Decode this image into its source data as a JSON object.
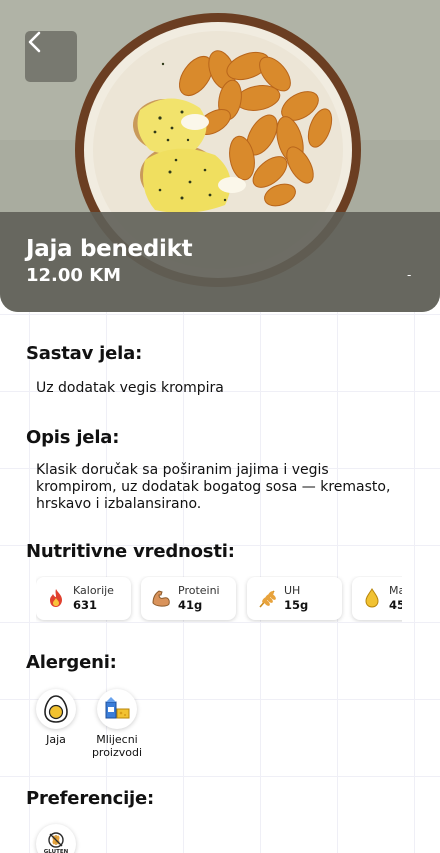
{
  "dish": {
    "name": "Jaja benedikt",
    "price": "12.00 KM",
    "dash": "-"
  },
  "sections": {
    "ingredients_title": "Sastav jela:",
    "ingredients_text": "Uz dodatak vegis krompira",
    "description_title": "Opis jela:",
    "description_text": "Klasik doručak sa poširanim jajima i vegis krompirom, uz dodatak bogatog sosa — kremasto, hrskavo i izbalansirano.",
    "nutrition_title": "Nutritivne vrednosti:",
    "allergens_title": "Alergeni:",
    "preferences_title": "Preferencije:"
  },
  "nutrition": [
    {
      "label": "Kalorije",
      "value": "631",
      "icon": "flame-icon"
    },
    {
      "label": "Proteini",
      "value": "41g",
      "icon": "muscle-icon"
    },
    {
      "label": "UH",
      "value": "15g",
      "icon": "wheat-icon"
    },
    {
      "label": "Ma",
      "value": "45",
      "icon": "oil-drop-icon"
    }
  ],
  "allergens": [
    {
      "label": "Jaja",
      "icon": "egg-icon"
    },
    {
      "label": "Mlijecni proizvodi",
      "icon": "dairy-icon"
    }
  ],
  "preferences": [
    {
      "label": "GLUTEN FREE",
      "icon": "gluten-free-icon"
    }
  ],
  "colors": {
    "overlay": "#5f5f58",
    "accent_orange": "#e8a33c",
    "grid": "#efeff6"
  }
}
